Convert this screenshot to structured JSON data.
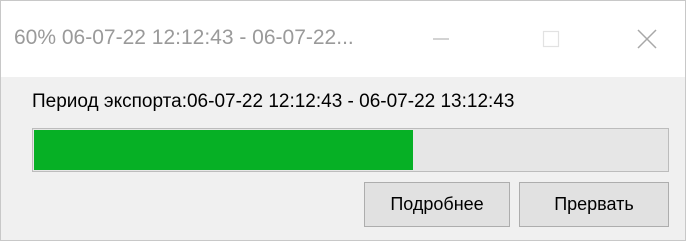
{
  "window": {
    "title": "60% 06-07-22 12:12:43 - 06-07-22..."
  },
  "export": {
    "period_label": "Период экспорта:06-07-22 12:12:43 - 06-07-22 13:12:43",
    "progress_percent": 60,
    "progress_color": "#06b025"
  },
  "buttons": {
    "details_label": "Подробнее",
    "abort_label": "Прервать"
  },
  "icons": {
    "minimize": "minimize-icon",
    "maximize": "maximize-icon",
    "close": "close-icon"
  }
}
